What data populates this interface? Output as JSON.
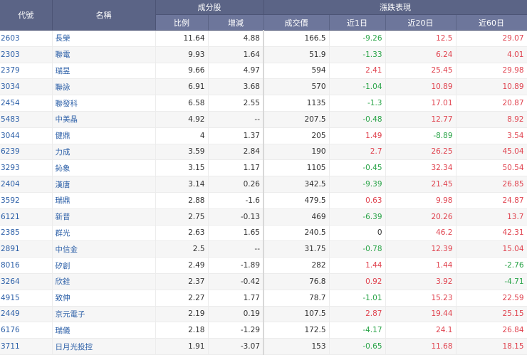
{
  "header": {
    "code": "代號",
    "name": "名稱",
    "components": "成分股",
    "ratio": "比例",
    "change": "增減",
    "price": "成交價",
    "performance": "漲跌表現",
    "d1": "近1日",
    "d20": "近20日",
    "d60": "近60日"
  },
  "colors": {
    "header": "#5b6486",
    "subheader": "#6d769b",
    "up": "#e0434f",
    "down": "#2aa448",
    "link": "#2d60a8"
  },
  "rows": [
    {
      "code": "2603",
      "name": "長榮",
      "ratio": "11.64",
      "change": "4.88",
      "price": "166.5",
      "d1": "-9.26",
      "d20": "12.5",
      "d60": "29.07"
    },
    {
      "code": "2303",
      "name": "聯電",
      "ratio": "9.93",
      "change": "1.64",
      "price": "51.9",
      "d1": "-1.33",
      "d20": "6.24",
      "d60": "4.01"
    },
    {
      "code": "2379",
      "name": "瑞昱",
      "ratio": "9.66",
      "change": "4.97",
      "price": "594",
      "d1": "2.41",
      "d20": "25.45",
      "d60": "29.98"
    },
    {
      "code": "3034",
      "name": "聯詠",
      "ratio": "6.91",
      "change": "3.68",
      "price": "570",
      "d1": "-1.04",
      "d20": "10.89",
      "d60": "10.89"
    },
    {
      "code": "2454",
      "name": "聯發科",
      "ratio": "6.58",
      "change": "2.55",
      "price": "1135",
      "d1": "-1.3",
      "d20": "17.01",
      "d60": "20.87"
    },
    {
      "code": "5483",
      "name": "中美晶",
      "ratio": "4.92",
      "change": "--",
      "price": "207.5",
      "d1": "-0.48",
      "d20": "12.77",
      "d60": "8.92"
    },
    {
      "code": "3044",
      "name": "健鼎",
      "ratio": "4",
      "change": "1.37",
      "price": "205",
      "d1": "1.49",
      "d20": "-8.89",
      "d60": "3.54"
    },
    {
      "code": "6239",
      "name": "力成",
      "ratio": "3.59",
      "change": "2.84",
      "price": "190",
      "d1": "2.7",
      "d20": "26.25",
      "d60": "45.04"
    },
    {
      "code": "3293",
      "name": "鈊象",
      "ratio": "3.15",
      "change": "1.17",
      "price": "1105",
      "d1": "-0.45",
      "d20": "32.34",
      "d60": "50.54"
    },
    {
      "code": "2404",
      "name": "漢唐",
      "ratio": "3.14",
      "change": "0.26",
      "price": "342.5",
      "d1": "-9.39",
      "d20": "21.45",
      "d60": "26.85"
    },
    {
      "code": "3592",
      "name": "瑞鼎",
      "ratio": "2.88",
      "change": "-1.6",
      "price": "479.5",
      "d1": "0.63",
      "d20": "9.98",
      "d60": "24.87"
    },
    {
      "code": "6121",
      "name": "新普",
      "ratio": "2.75",
      "change": "-0.13",
      "price": "469",
      "d1": "-6.39",
      "d20": "20.26",
      "d60": "13.7"
    },
    {
      "code": "2385",
      "name": "群光",
      "ratio": "2.63",
      "change": "1.65",
      "price": "240.5",
      "d1": "0",
      "d20": "46.2",
      "d60": "42.31"
    },
    {
      "code": "2891",
      "name": "中信金",
      "ratio": "2.5",
      "change": "--",
      "price": "31.75",
      "d1": "-0.78",
      "d20": "12.39",
      "d60": "15.04"
    },
    {
      "code": "8016",
      "name": "矽創",
      "ratio": "2.49",
      "change": "-1.89",
      "price": "282",
      "d1": "1.44",
      "d20": "1.44",
      "d60": "-2.76"
    },
    {
      "code": "3264",
      "name": "欣銓",
      "ratio": "2.37",
      "change": "-0.42",
      "price": "76.8",
      "d1": "0.92",
      "d20": "3.92",
      "d60": "-4.71"
    },
    {
      "code": "4915",
      "name": "致伸",
      "ratio": "2.27",
      "change": "1.77",
      "price": "78.7",
      "d1": "-1.01",
      "d20": "15.23",
      "d60": "22.59"
    },
    {
      "code": "2449",
      "name": "京元電子",
      "ratio": "2.19",
      "change": "0.19",
      "price": "107.5",
      "d1": "2.87",
      "d20": "19.44",
      "d60": "25.15"
    },
    {
      "code": "6176",
      "name": "瑞儀",
      "ratio": "2.18",
      "change": "-1.29",
      "price": "172.5",
      "d1": "-4.17",
      "d20": "24.1",
      "d60": "26.84"
    },
    {
      "code": "3711",
      "name": "日月光投控",
      "ratio": "1.91",
      "change": "-3.07",
      "price": "153",
      "d1": "-0.65",
      "d20": "11.68",
      "d60": "18.15"
    }
  ]
}
